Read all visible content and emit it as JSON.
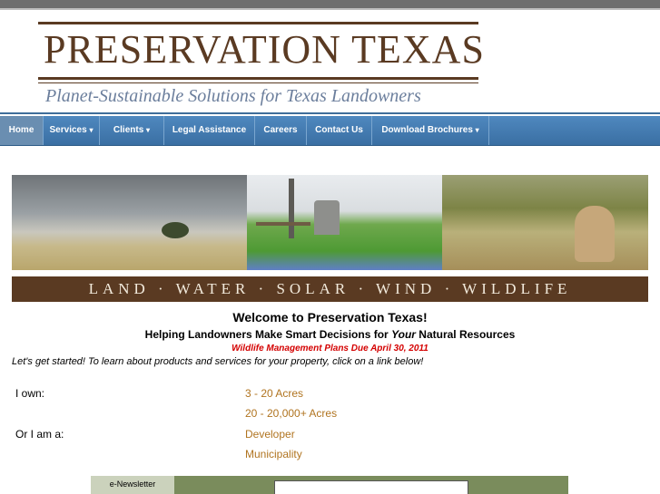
{
  "header": {
    "title": "PRESERVATION TEXAS",
    "tagline": "Planet-Sustainable Solutions for Texas Landowners"
  },
  "nav": {
    "items": [
      {
        "label": "Home"
      },
      {
        "label": "Services"
      },
      {
        "label": "Clients"
      },
      {
        "label": "Legal Assistance"
      },
      {
        "label": "Careers"
      },
      {
        "label": "Contact Us"
      },
      {
        "label": "Download Brochures"
      }
    ]
  },
  "banner": {
    "band_text": "LAND · WATER · SOLAR · WIND · WILDLIFE"
  },
  "main": {
    "welcome": "Welcome to Preservation Texas!",
    "subtitle_prefix": "Helping Landowners Make Smart Decisions for ",
    "subtitle_emphasis": "Your",
    "subtitle_suffix": " Natural Resources",
    "alert": "Wildlife Management Plans Due April 30, 2011",
    "intro": "Let's get started!  To learn about products and services for your property, click on a link below!",
    "own_label": "I own:",
    "own_links": [
      "3 - 20 Acres",
      "20 - 20,000+ Acres"
    ],
    "role_label": "Or I am a:",
    "role_links": [
      "Developer",
      "Municipality"
    ]
  },
  "newsletter": {
    "label": "e-Newsletter"
  },
  "colors": {
    "brand_brown": "#5a3a22",
    "nav_blue": "#4a82b8",
    "link_orange": "#b07420",
    "alert_red": "#d40000"
  }
}
